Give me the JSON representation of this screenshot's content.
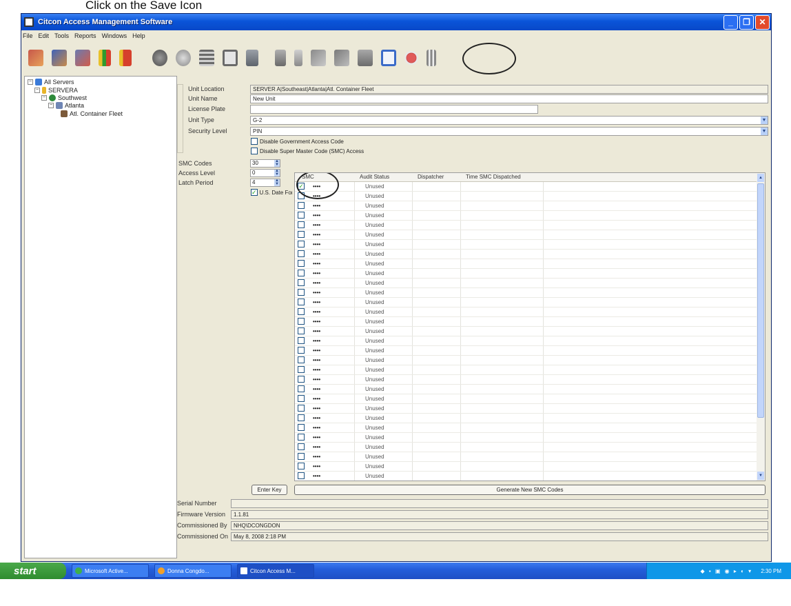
{
  "instruction": "Click on the Save Icon",
  "window": {
    "title": "Citcon Access Management Software"
  },
  "menu": [
    "File",
    "Edit",
    "Tools",
    "Reports",
    "Windows",
    "Help"
  ],
  "toolbar_icons": [
    "unit-icon",
    "add-unit-icon",
    "remove-unit-icon",
    "report-icon",
    "report2-icon",
    "globe-icon",
    "server-icon",
    "table-icon",
    "list-icon",
    "calculator-icon",
    "lock-icon",
    "padlock-icon",
    "copy-icon",
    "paste-icon",
    "properties-icon",
    "save-icon",
    "cancel-icon",
    "delete-icon"
  ],
  "tree": [
    {
      "label": "All Servers",
      "level": 0
    },
    {
      "label": "SERVERA",
      "level": 1
    },
    {
      "label": "Southwest",
      "level": 2
    },
    {
      "label": "Atlanta",
      "level": 3
    },
    {
      "label": "Atl. Container Fleet",
      "level": 4
    }
  ],
  "form": {
    "unit_location_label": "Unit Location",
    "unit_location": "SERVER A|Southeast|Atlanta|Atl. Container Fleet",
    "unit_name_label": "Unit Name",
    "unit_name": "New Unit",
    "license_plate_label": "License Plate",
    "license_plate": "",
    "unit_type_label": "Unit Type",
    "unit_type": "G-2",
    "security_level_label": "Security Level",
    "security_level": "PIN",
    "disable_gov_label": "Disable Government Access Code",
    "disable_smc_label": "Disable Super Master Code (SMC) Access",
    "smc_codes_label": "SMC Codes",
    "smc_codes": "30",
    "access_level_label": "Access Level",
    "access_level": "0",
    "latch_period_label": "Latch Period",
    "latch_period": "4",
    "us_date_label": "U.S. Date Format",
    "enter_key_label": "Enter Key",
    "generate_label": "Generate New SMC Codes",
    "serial_label": "Serial Number",
    "serial": "",
    "firmware_label": "Firmware Version",
    "firmware": "1.1.81",
    "comm_by_label": "Commissioned By",
    "comm_by": "NHQ\\DCONGDON",
    "comm_on_label": "Commissioned On",
    "comm_on": "May 8, 2008 2:18 PM"
  },
  "grid": {
    "headers": [
      "SMC",
      "Audit Status",
      "Dispatcher",
      "Time SMC Dispatched"
    ],
    "rows": [
      {
        "checked": true,
        "smc": "••••",
        "status": "Unused"
      },
      {
        "checked": false,
        "smc": "••••",
        "status": "Unused"
      },
      {
        "checked": false,
        "smc": "••••",
        "status": "Unused"
      },
      {
        "checked": false,
        "smc": "••••",
        "status": "Unused"
      },
      {
        "checked": false,
        "smc": "••••",
        "status": "Unused"
      },
      {
        "checked": false,
        "smc": "••••",
        "status": "Unused"
      },
      {
        "checked": false,
        "smc": "••••",
        "status": "Unused"
      },
      {
        "checked": false,
        "smc": "••••",
        "status": "Unused"
      },
      {
        "checked": false,
        "smc": "••••",
        "status": "Unused"
      },
      {
        "checked": false,
        "smc": "••••",
        "status": "Unused"
      },
      {
        "checked": false,
        "smc": "••••",
        "status": "Unused"
      },
      {
        "checked": false,
        "smc": "••••",
        "status": "Unused"
      },
      {
        "checked": false,
        "smc": "••••",
        "status": "Unused"
      },
      {
        "checked": false,
        "smc": "••••",
        "status": "Unused"
      },
      {
        "checked": false,
        "smc": "••••",
        "status": "Unused"
      },
      {
        "checked": false,
        "smc": "••••",
        "status": "Unused"
      },
      {
        "checked": false,
        "smc": "••••",
        "status": "Unused"
      },
      {
        "checked": false,
        "smc": "••••",
        "status": "Unused"
      },
      {
        "checked": false,
        "smc": "••••",
        "status": "Unused"
      },
      {
        "checked": false,
        "smc": "••••",
        "status": "Unused"
      },
      {
        "checked": false,
        "smc": "••••",
        "status": "Unused"
      },
      {
        "checked": false,
        "smc": "••••",
        "status": "Unused"
      },
      {
        "checked": false,
        "smc": "••••",
        "status": "Unused"
      },
      {
        "checked": false,
        "smc": "••••",
        "status": "Unused"
      },
      {
        "checked": false,
        "smc": "••••",
        "status": "Unused"
      },
      {
        "checked": false,
        "smc": "••••",
        "status": "Unused"
      },
      {
        "checked": false,
        "smc": "••••",
        "status": "Unused"
      },
      {
        "checked": false,
        "smc": "••••",
        "status": "Unused"
      },
      {
        "checked": false,
        "smc": "••••",
        "status": "Unused"
      },
      {
        "checked": false,
        "smc": "••••",
        "status": "Unused"
      },
      {
        "checked": false,
        "smc": "••••",
        "status": "Unused"
      }
    ]
  },
  "taskbar": {
    "start": "start",
    "tasks": [
      "Microsoft Active...",
      "Donna Congdo...",
      "Citcon Access M..."
    ],
    "clock": "2:30 PM"
  },
  "colors": {
    "titlebar": "#0a54d8",
    "selected_border": "#222222",
    "check": "#21a121"
  }
}
